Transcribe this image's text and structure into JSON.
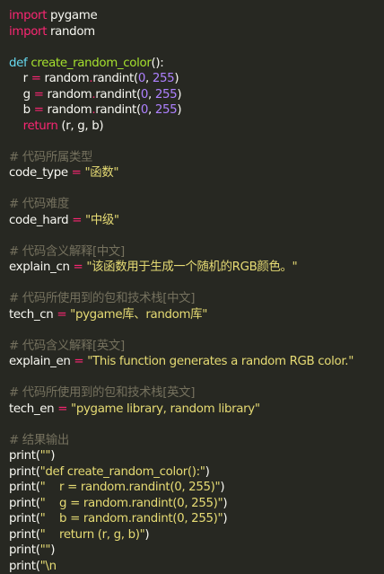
{
  "colors": {
    "background": "#272822",
    "foreground": "#f8f8f2",
    "keyword": "#f92672",
    "definition": "#66d9ef",
    "function": "#a6e22e",
    "string": "#e6db74",
    "number": "#ae81ff",
    "comment": "#75715e"
  },
  "lines": [
    [
      {
        "t": "kw",
        "v": "import"
      },
      {
        "t": "plain",
        "v": " pygame"
      }
    ],
    [
      {
        "t": "kw",
        "v": "import"
      },
      {
        "t": "plain",
        "v": " random"
      }
    ],
    [],
    [
      {
        "t": "def",
        "v": "def"
      },
      {
        "t": "plain",
        "v": " "
      },
      {
        "t": "fn",
        "v": "create_random_color"
      },
      {
        "t": "plain",
        "v": "():"
      }
    ],
    [
      {
        "t": "plain",
        "v": "    r "
      },
      {
        "t": "op",
        "v": "="
      },
      {
        "t": "plain",
        "v": " random"
      },
      {
        "t": "op",
        "v": "."
      },
      {
        "t": "plain",
        "v": "randint("
      },
      {
        "t": "num",
        "v": "0"
      },
      {
        "t": "plain",
        "v": ", "
      },
      {
        "t": "num",
        "v": "255"
      },
      {
        "t": "plain",
        "v": ")"
      }
    ],
    [
      {
        "t": "plain",
        "v": "    g "
      },
      {
        "t": "op",
        "v": "="
      },
      {
        "t": "plain",
        "v": " random"
      },
      {
        "t": "op",
        "v": "."
      },
      {
        "t": "plain",
        "v": "randint("
      },
      {
        "t": "num",
        "v": "0"
      },
      {
        "t": "plain",
        "v": ", "
      },
      {
        "t": "num",
        "v": "255"
      },
      {
        "t": "plain",
        "v": ")"
      }
    ],
    [
      {
        "t": "plain",
        "v": "    b "
      },
      {
        "t": "op",
        "v": "="
      },
      {
        "t": "plain",
        "v": " random"
      },
      {
        "t": "op",
        "v": "."
      },
      {
        "t": "plain",
        "v": "randint("
      },
      {
        "t": "num",
        "v": "0"
      },
      {
        "t": "plain",
        "v": ", "
      },
      {
        "t": "num",
        "v": "255"
      },
      {
        "t": "plain",
        "v": ")"
      }
    ],
    [
      {
        "t": "plain",
        "v": "    "
      },
      {
        "t": "kw",
        "v": "return"
      },
      {
        "t": "plain",
        "v": " (r, g, b)"
      }
    ],
    [],
    [
      {
        "t": "comment",
        "v": "# 代码所属类型"
      }
    ],
    [
      {
        "t": "plain",
        "v": "code_type "
      },
      {
        "t": "op",
        "v": "="
      },
      {
        "t": "plain",
        "v": " "
      },
      {
        "t": "str",
        "v": "\"函数\""
      }
    ],
    [],
    [
      {
        "t": "comment",
        "v": "# 代码难度"
      }
    ],
    [
      {
        "t": "plain",
        "v": "code_hard "
      },
      {
        "t": "op",
        "v": "="
      },
      {
        "t": "plain",
        "v": " "
      },
      {
        "t": "str",
        "v": "\"中级\""
      }
    ],
    [],
    [
      {
        "t": "comment",
        "v": "# 代码含义解释[中文]"
      }
    ],
    [
      {
        "t": "plain",
        "v": "explain_cn "
      },
      {
        "t": "op",
        "v": "="
      },
      {
        "t": "plain",
        "v": " "
      },
      {
        "t": "str",
        "v": "\"该函数用于生成一个随机的RGB颜色。\""
      }
    ],
    [],
    [
      {
        "t": "comment",
        "v": "# 代码所使用到的包和技术栈[中文]"
      }
    ],
    [
      {
        "t": "plain",
        "v": "tech_cn "
      },
      {
        "t": "op",
        "v": "="
      },
      {
        "t": "plain",
        "v": " "
      },
      {
        "t": "str",
        "v": "\"pygame库、random库\""
      }
    ],
    [],
    [
      {
        "t": "comment",
        "v": "# 代码含义解释[英文]"
      }
    ],
    [
      {
        "t": "plain",
        "v": "explain_en "
      },
      {
        "t": "op",
        "v": "="
      },
      {
        "t": "plain",
        "v": " "
      },
      {
        "t": "str",
        "v": "\"This function generates a random RGB color.\""
      }
    ],
    [],
    [
      {
        "t": "comment",
        "v": "# 代码所使用到的包和技术栈[英文]"
      }
    ],
    [
      {
        "t": "plain",
        "v": "tech_en "
      },
      {
        "t": "op",
        "v": "="
      },
      {
        "t": "plain",
        "v": " "
      },
      {
        "t": "str",
        "v": "\"pygame library, random library\""
      }
    ],
    [],
    [
      {
        "t": "comment",
        "v": "# 结果输出"
      }
    ],
    [
      {
        "t": "plain",
        "v": "print("
      },
      {
        "t": "str",
        "v": "\"\""
      },
      {
        "t": "plain",
        "v": ")"
      }
    ],
    [
      {
        "t": "plain",
        "v": "print("
      },
      {
        "t": "str",
        "v": "\"def create_random_color():\""
      },
      {
        "t": "plain",
        "v": ")"
      }
    ],
    [
      {
        "t": "plain",
        "v": "print("
      },
      {
        "t": "str",
        "v": "\"    r = random.randint(0, 255)\""
      },
      {
        "t": "plain",
        "v": ")"
      }
    ],
    [
      {
        "t": "plain",
        "v": "print("
      },
      {
        "t": "str",
        "v": "\"    g = random.randint(0, 255)\""
      },
      {
        "t": "plain",
        "v": ")"
      }
    ],
    [
      {
        "t": "plain",
        "v": "print("
      },
      {
        "t": "str",
        "v": "\"    b = random.randint(0, 255)\""
      },
      {
        "t": "plain",
        "v": ")"
      }
    ],
    [
      {
        "t": "plain",
        "v": "print("
      },
      {
        "t": "str",
        "v": "\"    return (r, g, b)\""
      },
      {
        "t": "plain",
        "v": ")"
      }
    ],
    [
      {
        "t": "plain",
        "v": "print("
      },
      {
        "t": "str",
        "v": "\"\""
      },
      {
        "t": "plain",
        "v": ")"
      }
    ],
    [
      {
        "t": "plain",
        "v": "print("
      },
      {
        "t": "str",
        "v": "\"\\n"
      }
    ]
  ]
}
